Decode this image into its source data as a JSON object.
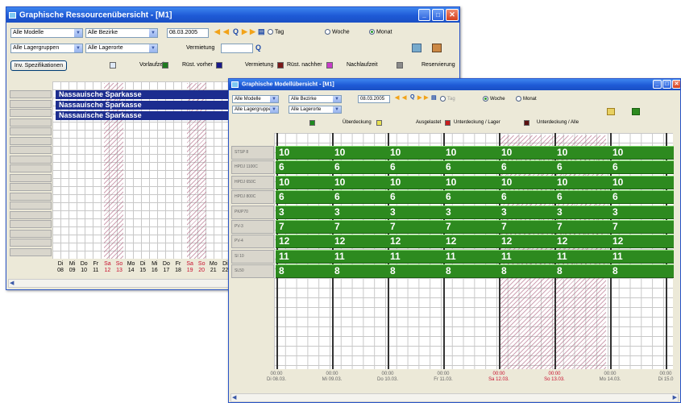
{
  "w1": {
    "title": "Graphische Ressourcenübersicht - [M1]",
    "models": "Alle Modelle",
    "districts": "Alle Bezirke",
    "groups": "Alle Lagergruppen",
    "locations": "Alle Lagerorte",
    "date": "08.03.2005",
    "view": {
      "day": "Tag",
      "week": "Woche",
      "month": "Monat"
    },
    "rental_label": "Vermietung",
    "inv_button": "Inv. Spezifikationen",
    "legend": [
      "Vorlaufzeit",
      "Rüst. vorher",
      "Vermietung",
      "Rüst. nachher",
      "Nachlaufzeit",
      "Reservierung"
    ],
    "legend_colors": [
      "#dfe9f7",
      "#1f7a1f",
      "#1a1a8a",
      "#7a1a1a",
      "#c83cc8",
      "#8a8a8a"
    ],
    "bookings": [
      "Nassauische Sparkasse",
      "Nassauische Sparkasse",
      "Nassauische Sparkasse"
    ],
    "days": [
      "Di",
      "Mi",
      "Do",
      "Fr",
      "Sa",
      "So",
      "Mo",
      "Di",
      "Mi",
      "Do",
      "Fr",
      "Sa",
      "So",
      "Mo",
      "Di"
    ],
    "dates": [
      "08",
      "09",
      "10",
      "11",
      "12",
      "13",
      "14",
      "15",
      "16",
      "17",
      "18",
      "19",
      "20",
      "21",
      "22"
    ],
    "weekend_color": "#c8102e"
  },
  "w2": {
    "title": "Graphische Modellübersicht - [M1]",
    "models": "Alle Modelle",
    "districts": "Alle Bezirke",
    "groups": "Alle Lagergruppen",
    "locations": "Alle Lagerorte",
    "date": "08.03.2005",
    "view": {
      "day": "Tag",
      "week": "Woche",
      "month": "Monat"
    },
    "legend": [
      "Überdeckung",
      "Ausgelastet",
      "Unterdeckung / Lager",
      "Unterdeckung / Alle"
    ],
    "legend_colors": [
      "#1f8a1f",
      "#e8e050",
      "#c81e1e",
      "#5a1010"
    ],
    "rows": [
      {
        "name": "STSP 8",
        "value": "10"
      },
      {
        "name": "HPDJ 1100C",
        "value": "6"
      },
      {
        "name": "HPDJ 650C",
        "value": "10"
      },
      {
        "name": "HPDJ 800C",
        "value": "6"
      },
      {
        "name": "PK/P70",
        "value": "3"
      },
      {
        "name": "PV-3",
        "value": "7"
      },
      {
        "name": "PV-4",
        "value": "12"
      },
      {
        "name": "SI 10",
        "value": "11"
      },
      {
        "name": "SL50",
        "value": "8"
      }
    ],
    "ticks": [
      {
        "time": "00:00",
        "date": "Di 08.03."
      },
      {
        "time": "00:00",
        "date": "Mi 09.03."
      },
      {
        "time": "00:00",
        "date": "Do 10.03."
      },
      {
        "time": "00:00",
        "date": "Fr 11.03."
      },
      {
        "time": "00:00",
        "date": "Sa 12.03."
      },
      {
        "time": "00:00",
        "date": "So 13.03."
      },
      {
        "time": "00:00",
        "date": "Mo 14.03."
      },
      {
        "time": "00:00",
        "date": "Di 15.0"
      }
    ]
  }
}
